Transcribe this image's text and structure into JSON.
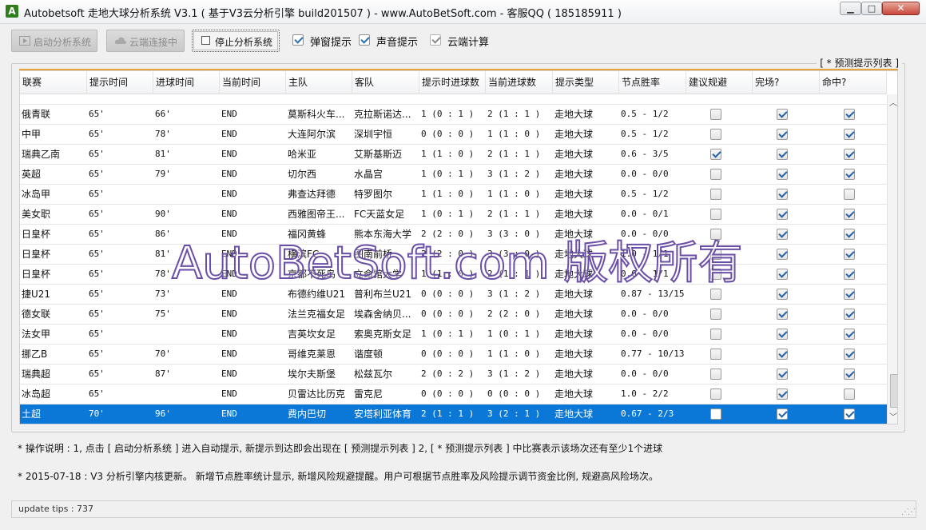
{
  "window": {
    "title": "Autobetsoft 走地大球分析系统 V3.1 ( 基于V3云分析引擎 build201507 ) - www.AutoBetSoft.com - 客服QQ ( 185185911 )",
    "icon_letter": "A",
    "minimize_glyph": "▁",
    "maximize_glyph": "□",
    "close_glyph": "✕"
  },
  "toolbar": {
    "start_label": "启动分析系统",
    "cloud_label": "云端连接中",
    "stop_label": "停止分析系统",
    "popup_label": "弹窗提示",
    "sound_label": "声音提示",
    "cloud_calc_label": "云端计算",
    "popup_checked": true,
    "sound_checked": true,
    "cloud_calc_checked": true
  },
  "group_title": "[ * 预测提示列表 ]",
  "columns": [
    "联赛",
    "提示时间",
    "进球时间",
    "当前时间",
    "主队",
    "客队",
    "提示时进球数",
    "当前进球数",
    "提示类型",
    "节点胜率",
    "建议规避",
    "完场?",
    "命中?"
  ],
  "rows": [
    {
      "league": "俄青联",
      "alert_time": "65'",
      "goal_time": "66'",
      "cur_time": "END",
      "home": "莫斯科火车...",
      "away": "克拉斯诺达...",
      "alert_score": "1 (0 : 1 )",
      "cur_score": "2 (1 : 1 )",
      "type": "走地大球",
      "rate": "0.5 - 1/2",
      "avoid": false,
      "finished": true,
      "hit": true
    },
    {
      "league": "中甲",
      "alert_time": "65'",
      "goal_time": "78'",
      "cur_time": "END",
      "home": "大连阿尔滨",
      "away": "深圳宇恒",
      "alert_score": "0 (0 : 0 )",
      "cur_score": "1 (1 : 0 )",
      "type": "走地大球",
      "rate": "0.5 - 1/2",
      "avoid": false,
      "finished": true,
      "hit": true
    },
    {
      "league": "瑞典乙南",
      "alert_time": "65'",
      "goal_time": "81'",
      "cur_time": "END",
      "home": "哈米亚",
      "away": "艾斯基斯迈",
      "alert_score": "1 (1 : 0 )",
      "cur_score": "2 (1 : 1 )",
      "type": "走地大球",
      "rate": "0.6 - 3/5",
      "avoid": true,
      "finished": true,
      "hit": true
    },
    {
      "league": "英超",
      "alert_time": "65'",
      "goal_time": "79'",
      "cur_time": "END",
      "home": "切尔西",
      "away": "水晶宫",
      "alert_score": "1 (0 : 1 )",
      "cur_score": "3 (1 : 2 )",
      "type": "走地大球",
      "rate": "0.0 - 0/0",
      "avoid": false,
      "finished": true,
      "hit": true
    },
    {
      "league": "冰岛甲",
      "alert_time": "65'",
      "goal_time": "",
      "cur_time": "END",
      "home": "弗查达拜德",
      "away": "特罗图尔",
      "alert_score": "1 (1 : 0 )",
      "cur_score": "1 (1 : 0 )",
      "type": "走地大球",
      "rate": "0.5 - 1/2",
      "avoid": false,
      "finished": true,
      "hit": false
    },
    {
      "league": "美女职",
      "alert_time": "65'",
      "goal_time": "90'",
      "cur_time": "END",
      "home": "西雅图帝王...",
      "away": "FC天蓝女足",
      "alert_score": "1 (0 : 1 )",
      "cur_score": "2 (1 : 1 )",
      "type": "走地大球",
      "rate": "0.0 - 0/1",
      "avoid": false,
      "finished": true,
      "hit": true
    },
    {
      "league": "日皇杯",
      "alert_time": "65'",
      "goal_time": "86'",
      "cur_time": "END",
      "home": "福冈黄蜂",
      "away": "熊本东海大学",
      "alert_score": "2 (2 : 0 )",
      "cur_score": "3 (3 : 0 )",
      "type": "走地大球",
      "rate": "0.0 - 0/0",
      "avoid": false,
      "finished": true,
      "hit": true
    },
    {
      "league": "日皇杯",
      "alert_time": "65'",
      "goal_time": "81'",
      "cur_time": "END",
      "home": "横滨FC",
      "away": "图南前桥",
      "alert_score": "2 (2 : 0 )",
      "cur_score": "3 (3 : 0 )",
      "type": "走地大球",
      "rate": "1.0 - 1/1",
      "avoid": false,
      "finished": true,
      "hit": true
    },
    {
      "league": "日皇杯",
      "alert_time": "65'",
      "goal_time": "78'",
      "cur_time": "END",
      "home": "京都不死鸟",
      "away": "立命馆大学",
      "alert_score": "1 (1 : 0 )",
      "cur_score": "2 (1 : 1 )",
      "type": "走地大球",
      "rate": "0.0 - 1/1",
      "avoid": false,
      "finished": true,
      "hit": true
    },
    {
      "league": "捷U21",
      "alert_time": "65'",
      "goal_time": "73'",
      "cur_time": "END",
      "home": "布德约维U21",
      "away": "普利布兰U21",
      "alert_score": "0 (0 : 0 )",
      "cur_score": "3 (1 : 2 )",
      "type": "走地大球",
      "rate": "0.87 - 13/15",
      "avoid": false,
      "finished": true,
      "hit": true
    },
    {
      "league": "德女联",
      "alert_time": "65'",
      "goal_time": "75'",
      "cur_time": "END",
      "home": "法兰克福女足",
      "away": "埃森舍纳贝...",
      "alert_score": "0 (0 : 0 )",
      "cur_score": "2 (2 : 0 )",
      "type": "走地大球",
      "rate": "0.0 - 0/0",
      "avoid": false,
      "finished": true,
      "hit": true
    },
    {
      "league": "法女甲",
      "alert_time": "65'",
      "goal_time": "",
      "cur_time": "END",
      "home": "吉英坎女足",
      "away": "索奥克斯女足",
      "alert_score": "1 (0 : 1 )",
      "cur_score": "1 (0 : 1 )",
      "type": "走地大球",
      "rate": "0.0 - 0/0",
      "avoid": false,
      "finished": true,
      "hit": true
    },
    {
      "league": "挪乙B",
      "alert_time": "65'",
      "goal_time": "70'",
      "cur_time": "END",
      "home": "哥维克莱恩",
      "away": "谐度顿",
      "alert_score": "0 (0 : 0 )",
      "cur_score": "1 (1 : 0 )",
      "type": "走地大球",
      "rate": "0.77 - 10/13",
      "avoid": false,
      "finished": true,
      "hit": true
    },
    {
      "league": "瑞典超",
      "alert_time": "65'",
      "goal_time": "87'",
      "cur_time": "END",
      "home": "埃尔夫斯堡",
      "away": "松兹瓦尔",
      "alert_score": "2 (0 : 2 )",
      "cur_score": "3 (1 : 2 )",
      "type": "走地大球",
      "rate": "0.0 - 0/0",
      "avoid": false,
      "finished": true,
      "hit": true
    },
    {
      "league": "冰岛超",
      "alert_time": "65'",
      "goal_time": "",
      "cur_time": "END",
      "home": "贝雷达比历克",
      "away": "雷克尼",
      "alert_score": "0 (0 : 0 )",
      "cur_score": "0 (0 : 0 )",
      "type": "走地大球",
      "rate": "1.0 - 2/2",
      "avoid": false,
      "finished": true,
      "hit": false
    },
    {
      "league": "土超",
      "alert_time": "70'",
      "goal_time": "96'",
      "cur_time": "END",
      "home": "费内巴切",
      "away": "安塔利亚体育",
      "alert_score": "2 (1 : 1 )",
      "cur_score": "3 (2 : 1 )",
      "type": "走地大球",
      "rate": "0.67 - 2/3",
      "avoid": false,
      "finished": true,
      "hit": true
    }
  ],
  "selected_row": 15,
  "notes": {
    "line1": "* 操作说明 : 1, 点击 [ 启动分析系统 ] 进入自动提示, 新提示到达即会出现在 [ 预测提示列表 ] 2, [ * 预测提示列表 ] 中比赛表示该场次还有至少1个进球",
    "line2": "* 2015-07-18 :  V3 分析引擎内核更新。 新增节点胜率统计显示, 新增风险规避提醒。用户可根据节点胜率及风险提示调节资金比例, 规避高风险场次。"
  },
  "status": {
    "text": "update tips : 737"
  },
  "watermark": "AutoBetSoft.com 版权所有",
  "colors": {
    "selection": "#0b78d7",
    "accent": "#e8a33c",
    "watermark_stroke": "#6a4ea8"
  }
}
